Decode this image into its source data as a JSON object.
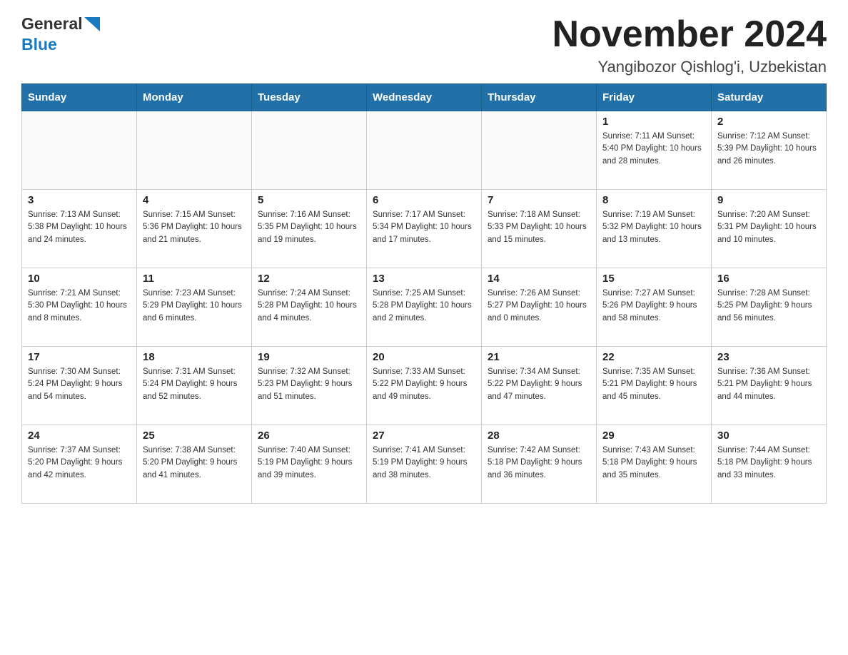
{
  "header": {
    "logo_general": "General",
    "logo_blue": "Blue",
    "month_title": "November 2024",
    "location": "Yangibozor Qishlog'i, Uzbekistan"
  },
  "days_of_week": [
    "Sunday",
    "Monday",
    "Tuesday",
    "Wednesday",
    "Thursday",
    "Friday",
    "Saturday"
  ],
  "weeks": [
    [
      {
        "day": "",
        "info": ""
      },
      {
        "day": "",
        "info": ""
      },
      {
        "day": "",
        "info": ""
      },
      {
        "day": "",
        "info": ""
      },
      {
        "day": "",
        "info": ""
      },
      {
        "day": "1",
        "info": "Sunrise: 7:11 AM\nSunset: 5:40 PM\nDaylight: 10 hours and 28 minutes."
      },
      {
        "day": "2",
        "info": "Sunrise: 7:12 AM\nSunset: 5:39 PM\nDaylight: 10 hours and 26 minutes."
      }
    ],
    [
      {
        "day": "3",
        "info": "Sunrise: 7:13 AM\nSunset: 5:38 PM\nDaylight: 10 hours and 24 minutes."
      },
      {
        "day": "4",
        "info": "Sunrise: 7:15 AM\nSunset: 5:36 PM\nDaylight: 10 hours and 21 minutes."
      },
      {
        "day": "5",
        "info": "Sunrise: 7:16 AM\nSunset: 5:35 PM\nDaylight: 10 hours and 19 minutes."
      },
      {
        "day": "6",
        "info": "Sunrise: 7:17 AM\nSunset: 5:34 PM\nDaylight: 10 hours and 17 minutes."
      },
      {
        "day": "7",
        "info": "Sunrise: 7:18 AM\nSunset: 5:33 PM\nDaylight: 10 hours and 15 minutes."
      },
      {
        "day": "8",
        "info": "Sunrise: 7:19 AM\nSunset: 5:32 PM\nDaylight: 10 hours and 13 minutes."
      },
      {
        "day": "9",
        "info": "Sunrise: 7:20 AM\nSunset: 5:31 PM\nDaylight: 10 hours and 10 minutes."
      }
    ],
    [
      {
        "day": "10",
        "info": "Sunrise: 7:21 AM\nSunset: 5:30 PM\nDaylight: 10 hours and 8 minutes."
      },
      {
        "day": "11",
        "info": "Sunrise: 7:23 AM\nSunset: 5:29 PM\nDaylight: 10 hours and 6 minutes."
      },
      {
        "day": "12",
        "info": "Sunrise: 7:24 AM\nSunset: 5:28 PM\nDaylight: 10 hours and 4 minutes."
      },
      {
        "day": "13",
        "info": "Sunrise: 7:25 AM\nSunset: 5:28 PM\nDaylight: 10 hours and 2 minutes."
      },
      {
        "day": "14",
        "info": "Sunrise: 7:26 AM\nSunset: 5:27 PM\nDaylight: 10 hours and 0 minutes."
      },
      {
        "day": "15",
        "info": "Sunrise: 7:27 AM\nSunset: 5:26 PM\nDaylight: 9 hours and 58 minutes."
      },
      {
        "day": "16",
        "info": "Sunrise: 7:28 AM\nSunset: 5:25 PM\nDaylight: 9 hours and 56 minutes."
      }
    ],
    [
      {
        "day": "17",
        "info": "Sunrise: 7:30 AM\nSunset: 5:24 PM\nDaylight: 9 hours and 54 minutes."
      },
      {
        "day": "18",
        "info": "Sunrise: 7:31 AM\nSunset: 5:24 PM\nDaylight: 9 hours and 52 minutes."
      },
      {
        "day": "19",
        "info": "Sunrise: 7:32 AM\nSunset: 5:23 PM\nDaylight: 9 hours and 51 minutes."
      },
      {
        "day": "20",
        "info": "Sunrise: 7:33 AM\nSunset: 5:22 PM\nDaylight: 9 hours and 49 minutes."
      },
      {
        "day": "21",
        "info": "Sunrise: 7:34 AM\nSunset: 5:22 PM\nDaylight: 9 hours and 47 minutes."
      },
      {
        "day": "22",
        "info": "Sunrise: 7:35 AM\nSunset: 5:21 PM\nDaylight: 9 hours and 45 minutes."
      },
      {
        "day": "23",
        "info": "Sunrise: 7:36 AM\nSunset: 5:21 PM\nDaylight: 9 hours and 44 minutes."
      }
    ],
    [
      {
        "day": "24",
        "info": "Sunrise: 7:37 AM\nSunset: 5:20 PM\nDaylight: 9 hours and 42 minutes."
      },
      {
        "day": "25",
        "info": "Sunrise: 7:38 AM\nSunset: 5:20 PM\nDaylight: 9 hours and 41 minutes."
      },
      {
        "day": "26",
        "info": "Sunrise: 7:40 AM\nSunset: 5:19 PM\nDaylight: 9 hours and 39 minutes."
      },
      {
        "day": "27",
        "info": "Sunrise: 7:41 AM\nSunset: 5:19 PM\nDaylight: 9 hours and 38 minutes."
      },
      {
        "day": "28",
        "info": "Sunrise: 7:42 AM\nSunset: 5:18 PM\nDaylight: 9 hours and 36 minutes."
      },
      {
        "day": "29",
        "info": "Sunrise: 7:43 AM\nSunset: 5:18 PM\nDaylight: 9 hours and 35 minutes."
      },
      {
        "day": "30",
        "info": "Sunrise: 7:44 AM\nSunset: 5:18 PM\nDaylight: 9 hours and 33 minutes."
      }
    ]
  ]
}
